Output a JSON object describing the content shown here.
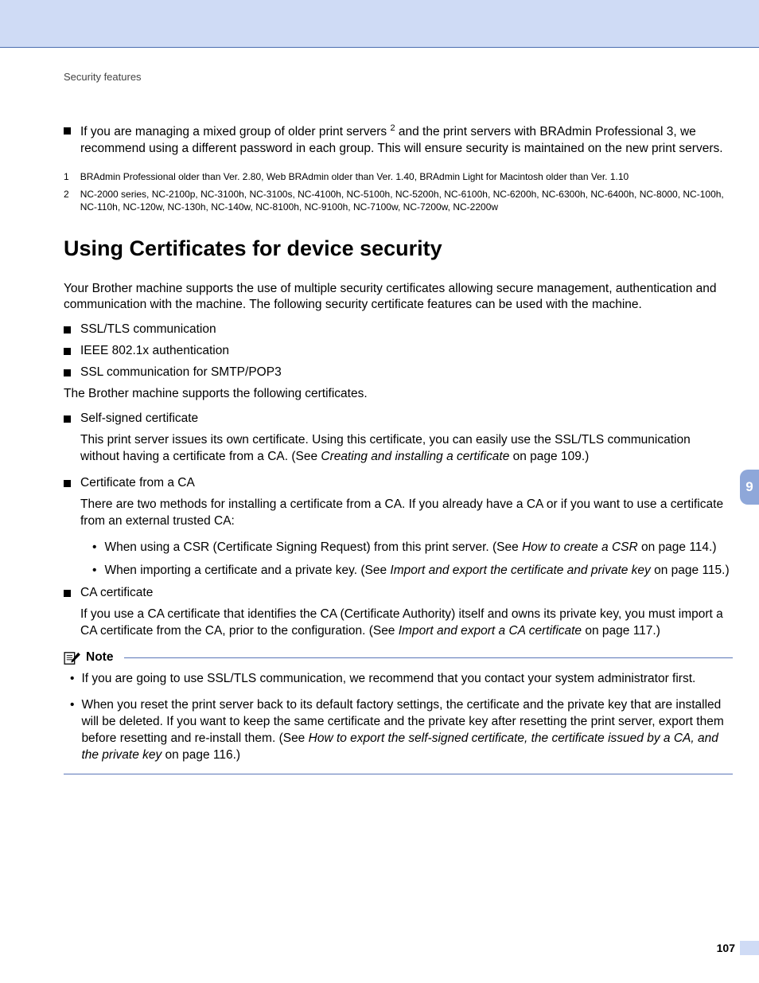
{
  "runningHead": "Security features",
  "intro": {
    "bullet1_a": "If you are managing a mixed group of older print servers ",
    "bullet1_sup": "2",
    "bullet1_b": " and the print servers with BRAdmin Professional 3, we recommend using a different password in each group. This will ensure security is maintained on the new print servers."
  },
  "footnotes": {
    "fn1_sup": "1",
    "fn1": "BRAdmin Professional older than Ver. 2.80, Web BRAdmin older than Ver. 1.40, BRAdmin Light for Macintosh older than Ver. 1.10",
    "fn2_sup": "2",
    "fn2": "NC-2000 series, NC-2100p, NC-3100h, NC-3100s, NC-4100h, NC-5100h, NC-5200h, NC-6100h, NC-6200h, NC-6300h, NC-6400h, NC-8000, NC-100h, NC-110h, NC-120w, NC-130h, NC-140w, NC-8100h, NC-9100h, NC-7100w, NC-7200w, NC-2200w"
  },
  "heading": "Using Certificates for device security",
  "p1": "Your Brother machine supports the use of multiple security certificates allowing secure management, authentication and communication with the machine. The following security certificate features can be used with the machine.",
  "featureList": {
    "a": "SSL/TLS communication",
    "b": "IEEE 802.1x authentication",
    "c": "SSL communication for SMTP/POP3"
  },
  "p2": "The Brother machine supports the following certificates.",
  "certs": {
    "selfTitle": "Self-signed certificate",
    "selfBody_a": "This print server issues its own certificate. Using this certificate, you can easily use the SSL/TLS communication without having a certificate from a CA. (See ",
    "selfBody_i": "Creating and installing a certificate",
    "selfBody_b": " on page 109.)",
    "caTitle": "Certificate from a CA",
    "caBody": "There are two methods for installing a certificate from a CA. If you already have a CA or if you want to use a certificate from an external trusted CA:",
    "caSub1_a": "When using a CSR (Certificate Signing Request) from this print server. (See ",
    "caSub1_i": "How to create a CSR",
    "caSub1_b": " on page 114.)",
    "caSub2_a": "When importing a certificate and a private key. (See ",
    "caSub2_i": "Import and export the certificate and private key",
    "caSub2_b": " on page 115.)",
    "caCertTitle": "CA certificate",
    "caCertBody_a": "If you use a CA certificate that identifies the CA (Certificate Authority) itself and owns its private key, you must import a CA certificate from the CA, prior to the configuration. (See ",
    "caCertBody_i": "Import and export a CA certificate",
    "caCertBody_b": " on page 117.)"
  },
  "note": {
    "label": "Note",
    "item1": "If you are going to use SSL/TLS communication, we recommend that you contact your system administrator first.",
    "item2_a": "When you reset the print server back to its default factory settings, the certificate and the private key that are installed will be deleted. If you want to keep the same certificate and the private key after resetting the print server, export them before resetting and re-install them. (See ",
    "item2_i": "How to export the self-signed certificate, the certificate issued by a CA, and the private key",
    "item2_b": " on page 116.)"
  },
  "sideTab": "9",
  "pageNumber": "107"
}
